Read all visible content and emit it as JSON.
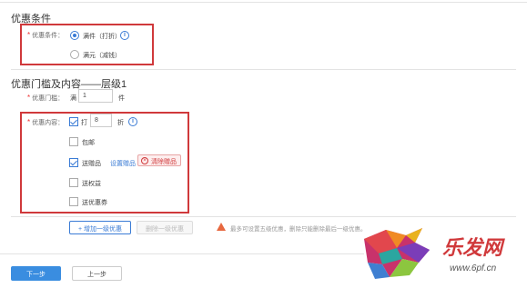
{
  "conditions": {
    "title": "优惠条件",
    "label": "优惠条件：",
    "option1": "满件（打折）",
    "option2": "满元（减钱）"
  },
  "tier": {
    "title": "优惠门槛及内容——层级1",
    "threshold_label": "优惠门槛：",
    "threshold_prefix": "满",
    "threshold_value": "1",
    "threshold_unit": "件",
    "content_label": "优惠内容：",
    "discount_prefix": "打",
    "discount_value": "8",
    "discount_unit": "折",
    "free_shipping": "包邮",
    "gift": "送赠品",
    "set_gift_link": "设置赠品",
    "clear_gift": "清除赠品",
    "coupon": "送权益",
    "bonus": "送优惠券"
  },
  "actions": {
    "add_tier": "+ 增加一级优惠",
    "delete_tier": "删除一级优惠",
    "warning": "最多可设置五级优惠，删除只能删除最后一级优惠。",
    "next": "下一步",
    "prev": "上一步"
  },
  "watermark": {
    "brand": "乐发网",
    "url": "www.6pf.cn"
  },
  "colors": {
    "accent": "#3a7bd5",
    "highlight": "#d0393b"
  }
}
